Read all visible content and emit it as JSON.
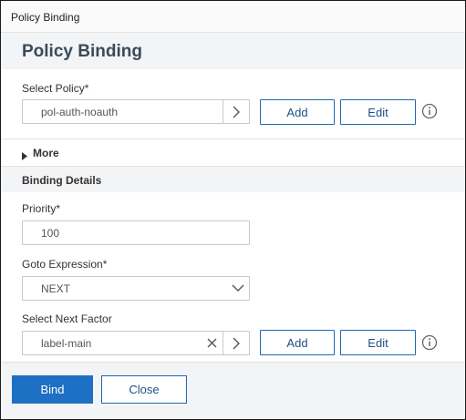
{
  "window": {
    "title": "Policy Binding"
  },
  "header": {
    "heading": "Policy Binding"
  },
  "select_policy": {
    "label": "Select Policy*",
    "value": "pol-auth-noauth",
    "add_label": "Add",
    "edit_label": "Edit"
  },
  "more": {
    "label": "More"
  },
  "binding_details": {
    "heading": "Binding Details",
    "priority": {
      "label": "Priority*",
      "value": "100"
    },
    "goto_expression": {
      "label": "Goto Expression*",
      "value": "NEXT"
    },
    "next_factor": {
      "label": "Select Next Factor",
      "value": "label-main",
      "add_label": "Add",
      "edit_label": "Edit"
    }
  },
  "footer": {
    "bind_label": "Bind",
    "close_label": "Close"
  },
  "colors": {
    "primary": "#1d70c4",
    "border": "#c6c9cd",
    "band": "#f3f4f6"
  },
  "icons": [
    "chevron-right-icon",
    "info-icon",
    "caret-right-icon",
    "chevron-down-icon",
    "clear-x-icon"
  ]
}
